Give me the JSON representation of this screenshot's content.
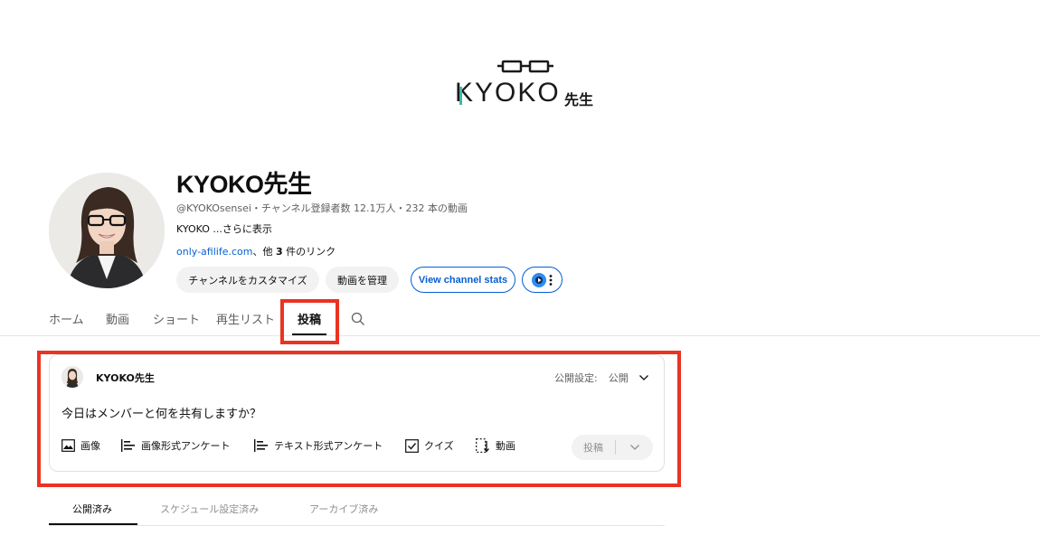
{
  "banner": {
    "logo_text": "KYOKO",
    "logo_suffix": "先生"
  },
  "channel": {
    "name": "KYOKO先生",
    "meta": "@KYOKOsensei・チャンネル登録者数 12.1万人・232 本の動画",
    "description": "KYOKO ...さらに表示",
    "link_text": "only-afilife.com",
    "link_suffix_prefix": "、他 ",
    "link_count": "3",
    "link_suffix_post": " 件のリンク"
  },
  "buttons": {
    "customize": "チャンネルをカスタマイズ",
    "manage_videos": "動画を管理",
    "view_stats": "View channel stats"
  },
  "tabs": [
    "ホーム",
    "動画",
    "ショート",
    "再生リスト",
    "投稿"
  ],
  "active_tab": "投稿",
  "composer": {
    "author": "KYOKO先生",
    "visibility_label": "公開設定:",
    "visibility_value": "公開",
    "placeholder": "今日はメンバーと何を共有しますか？",
    "tools": [
      "画像",
      "画像形式アンケート",
      "テキスト形式アンケート",
      "クイズ",
      "動画"
    ],
    "post_button": "投稿"
  },
  "subtabs": [
    "公開済み",
    "スケジュール設定済み",
    "アーカイブ済み"
  ],
  "active_subtab": "公開済み",
  "colors": {
    "highlight": "#ea3323",
    "link": "#065fd4",
    "logo_accent": "#3fb6a8"
  }
}
